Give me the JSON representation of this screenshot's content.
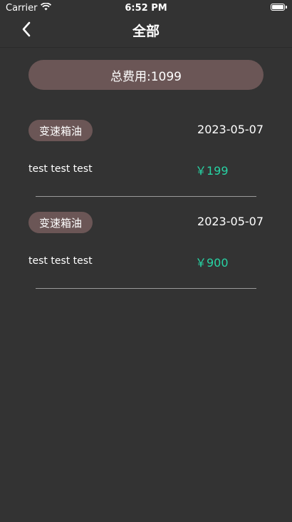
{
  "status_bar": {
    "carrier": "Carrier",
    "time": "6:52 PM"
  },
  "nav": {
    "title": "全部"
  },
  "summary": {
    "total_label": "总费用:1099"
  },
  "records": [
    {
      "tag": "变速箱油",
      "date": "2023-05-07",
      "desc": "test test test",
      "price": "￥199"
    },
    {
      "tag": "变速箱油",
      "date": "2023-05-07",
      "desc": "test test test",
      "price": "￥900"
    }
  ],
  "colors": {
    "background": "#333333",
    "pill": "#6b5656",
    "price": "#27d3a4"
  },
  "icons": {
    "back": "chevron-left-icon",
    "wifi": "wifi-icon",
    "battery": "battery-icon"
  }
}
